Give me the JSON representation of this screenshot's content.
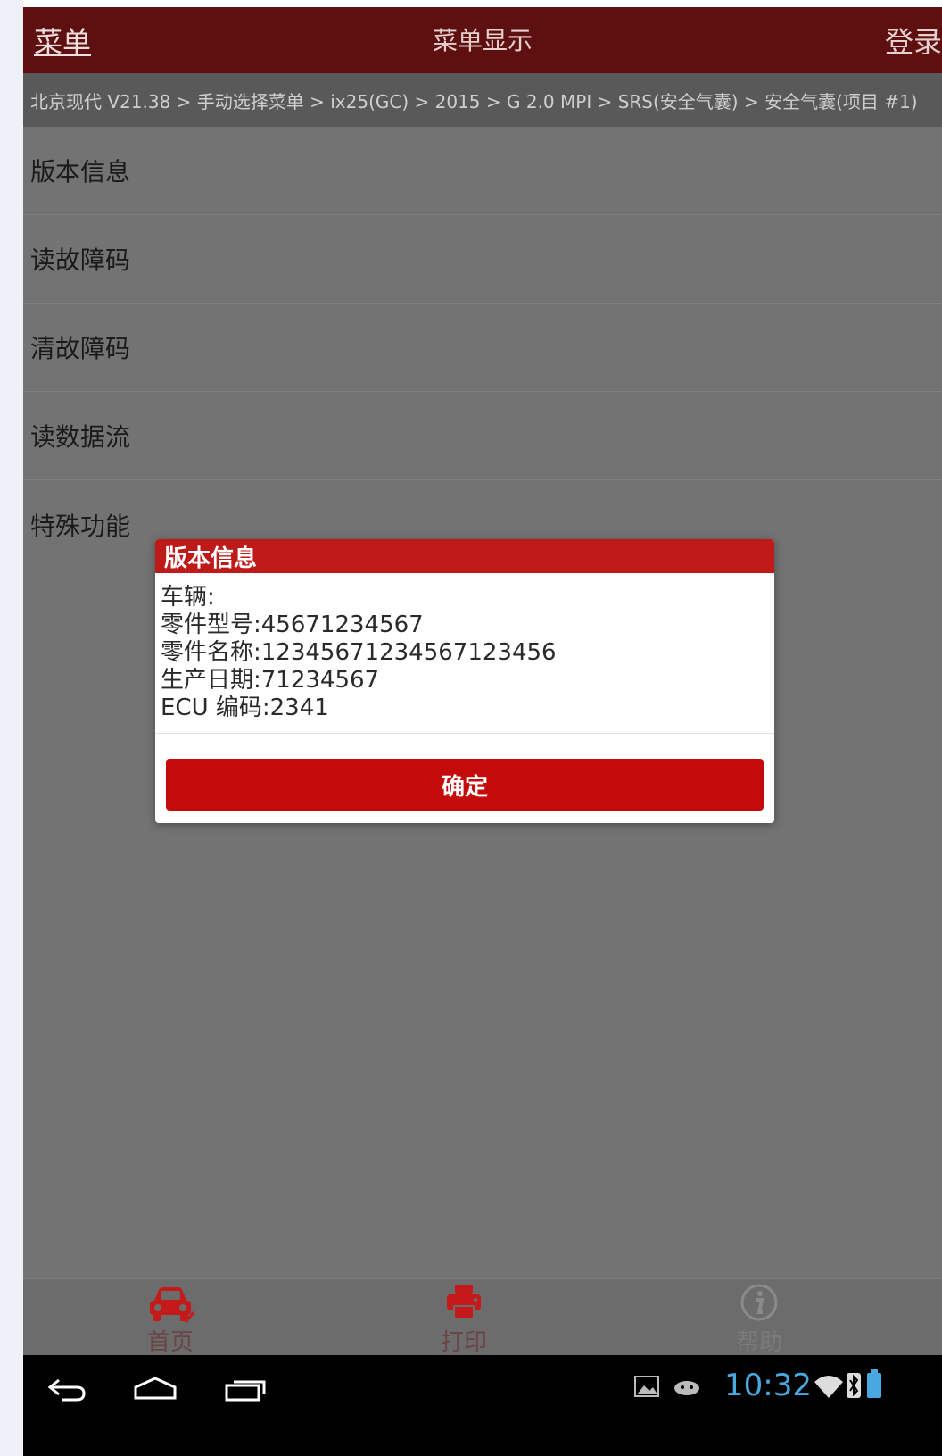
{
  "header": {
    "menu_label": "菜单",
    "title": "菜单显示",
    "login_label": "登录"
  },
  "breadcrumb": "北京现代 V21.38 > 手动选择菜单 > ix25(GC) > 2015 > G 2.0 MPI > SRS(安全气囊) > 安全气囊(项目 #1)",
  "menu": {
    "items": [
      {
        "label": "版本信息"
      },
      {
        "label": "读故障码"
      },
      {
        "label": "清故障码"
      },
      {
        "label": "读数据流"
      },
      {
        "label": "特殊功能"
      }
    ]
  },
  "dialog": {
    "title": "版本信息",
    "lines": [
      "车辆:",
      "零件型号:45671234567",
      "零件名称:12345671234567123456",
      "生产日期:71234567",
      "ECU 编码:2341"
    ],
    "ok_label": "确定"
  },
  "toolbar": {
    "home_label": "首页",
    "print_label": "打印",
    "help_label": "帮助"
  },
  "status": {
    "time": "10:32"
  },
  "colors": {
    "header_bg": "#5e0f0f",
    "accent_red": "#c40a0a",
    "clock_blue": "#4aa8e0"
  }
}
